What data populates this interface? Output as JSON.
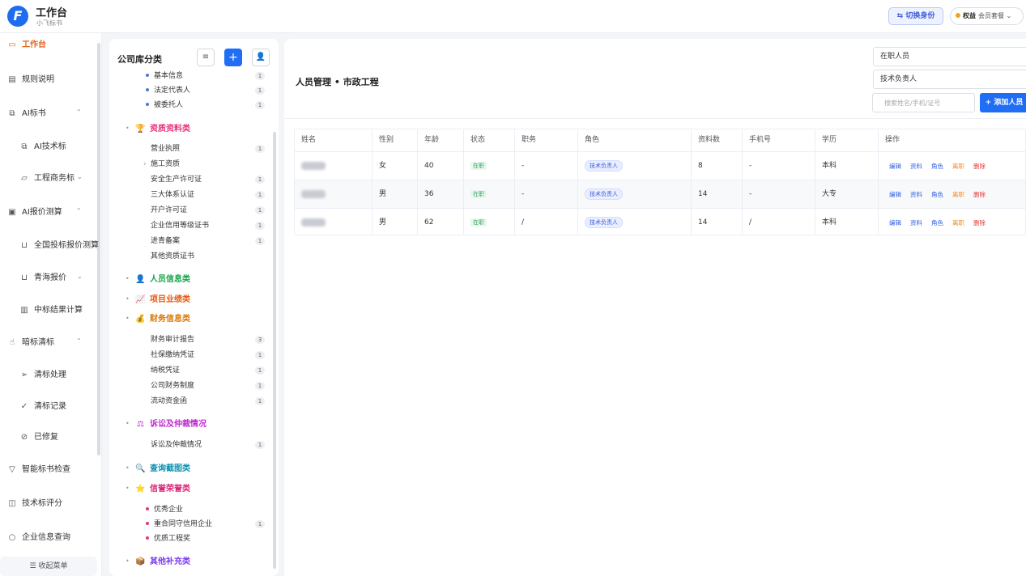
{
  "header": {
    "logo": "F",
    "title": "工作台",
    "subtitle": "小飞标书",
    "switch_label": "切换身份",
    "rights_label": "权益",
    "rights_plan": "会员套餐"
  },
  "sidebar": {
    "items": [
      {
        "label": "工作台",
        "icon": "monitor-icon"
      },
      {
        "label": "规则说明",
        "icon": "doc-icon"
      },
      {
        "label": "AI标书",
        "icon": "copy-icon"
      },
      {
        "label": "AI技术标",
        "icon": "copy-icon"
      },
      {
        "label": "工程商务标",
        "icon": "folder-icon"
      },
      {
        "label": "AI报价测算",
        "icon": "screen-icon"
      },
      {
        "label": "全国投标报价测算",
        "icon": "cart-icon"
      },
      {
        "label": "青海报价",
        "icon": "cart-icon"
      },
      {
        "label": "中标结果计算",
        "icon": "calc-icon"
      },
      {
        "label": "暗标清标",
        "icon": "hand-icon"
      },
      {
        "label": "清标处理",
        "icon": "send-icon"
      },
      {
        "label": "清标记录",
        "icon": "check-list-icon"
      },
      {
        "label": "已修复",
        "icon": "circle-check-icon"
      },
      {
        "label": "智能标书检查",
        "icon": "filter-icon"
      },
      {
        "label": "技术标评分",
        "icon": "cup-icon"
      },
      {
        "label": "企业信息查询",
        "icon": "search-icon"
      }
    ],
    "collapse_label": "收起菜单"
  },
  "category": {
    "title": "公司库分类",
    "rows": [
      {
        "text": "基本信息",
        "count": "1"
      },
      {
        "text": "法定代表人",
        "count": "1"
      },
      {
        "text": "被委托人",
        "count": "1"
      },
      {
        "cat": "资质资料类",
        "color": "#e8317a",
        "icon": "trophy-icon"
      },
      {
        "text": "营业执照",
        "count": "1"
      },
      {
        "text": "施工资质",
        "count": ""
      },
      {
        "text": "安全生产许可证",
        "count": "1"
      },
      {
        "text": "三大体系认证",
        "count": "1"
      },
      {
        "text": "开户许可证",
        "count": "1"
      },
      {
        "text": "企业信用等级证书",
        "count": "1"
      },
      {
        "text": "进青备案",
        "count": "1"
      },
      {
        "text": "其他资质证书",
        "count": ""
      },
      {
        "cat": "人员信息类",
        "color": "#16a34a",
        "icon": "person-icon"
      },
      {
        "cat": "项目业绩类",
        "color": "#ea580c",
        "icon": "chart-icon"
      },
      {
        "cat": "财务信息类",
        "color": "#d97706",
        "icon": "money-bag-icon"
      },
      {
        "text": "财务审计报告",
        "count": "3"
      },
      {
        "text": "社保缴纳凭证",
        "count": "1"
      },
      {
        "text": "纳税凭证",
        "count": "1"
      },
      {
        "text": "公司财务制度",
        "count": "1"
      },
      {
        "text": "流动资金函",
        "count": "1"
      },
      {
        "cat": "诉讼及仲裁情况",
        "color": "#c026d3",
        "icon": "scales-icon"
      },
      {
        "text": "诉讼及仲裁情况",
        "count": "1"
      },
      {
        "cat": "查询截图类",
        "color": "#0891b2",
        "icon": "magnifier-icon"
      },
      {
        "cat": "信誉荣誉类",
        "color": "#db2777",
        "icon": "star-icon"
      },
      {
        "text": "优秀企业",
        "count": ""
      },
      {
        "text": "重合同守信用企业",
        "count": "1"
      },
      {
        "text": "优质工程奖",
        "count": ""
      },
      {
        "cat": "其他补充类",
        "color": "#7c3aed",
        "icon": "box-icon"
      }
    ]
  },
  "main": {
    "title": "人员管理 • 市政工程",
    "filter1": "在职人员",
    "filter2": "技术负责人",
    "search_placeholder": "搜索姓名/手机/证号",
    "add_label": "+ 添加人员",
    "columns": [
      "姓名",
      "性别",
      "年龄",
      "状态",
      "职务",
      "角色",
      "资料数",
      "手机号",
      "学历",
      "操作"
    ],
    "rows": [
      {
        "gender": "女",
        "age": "40",
        "status": "在职",
        "post": "-",
        "role": "技术负责人",
        "docs": "8",
        "phone": "-",
        "edu": "本科"
      },
      {
        "gender": "男",
        "age": "36",
        "status": "在职",
        "post": "-",
        "role": "技术负责人",
        "docs": "14",
        "phone": "-",
        "edu": "大专"
      },
      {
        "gender": "男",
        "age": "62",
        "status": "在职",
        "post": "/",
        "role": "技术负责人",
        "docs": "14",
        "phone": "/",
        "edu": "本科"
      }
    ],
    "ops": [
      "编辑",
      "资料",
      "角色",
      "离职",
      "删除"
    ]
  }
}
